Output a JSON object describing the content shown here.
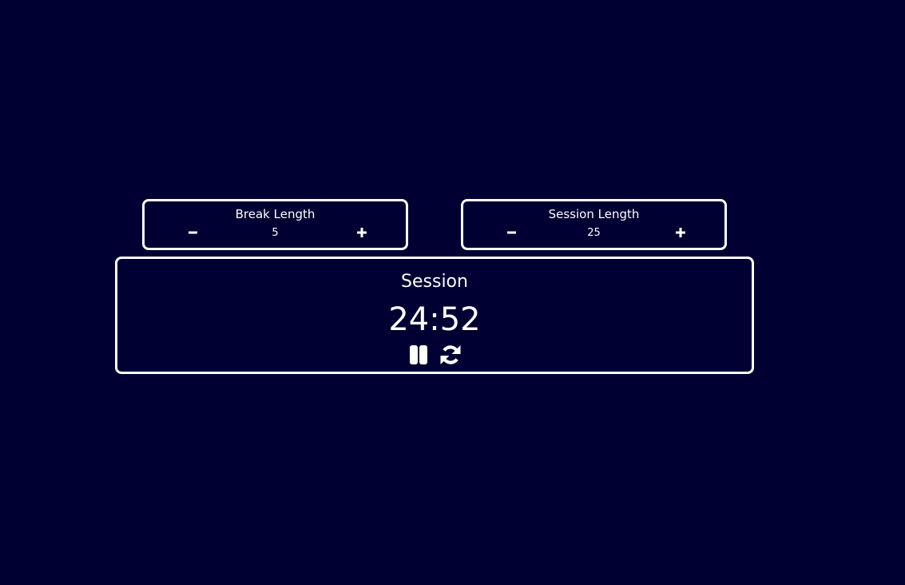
{
  "break": {
    "label": "Break Length",
    "value": "5",
    "decrement_icon": "minus-icon",
    "increment_icon": "plus-icon"
  },
  "session": {
    "label": "Session Length",
    "value": "25",
    "decrement_icon": "minus-icon",
    "increment_icon": "plus-icon"
  },
  "timer": {
    "label": "Session",
    "time_left": "24:52",
    "pause_icon": "pause-icon",
    "reset_icon": "refresh-icon"
  },
  "colors": {
    "background": "#000033",
    "foreground": "#ffffff"
  }
}
